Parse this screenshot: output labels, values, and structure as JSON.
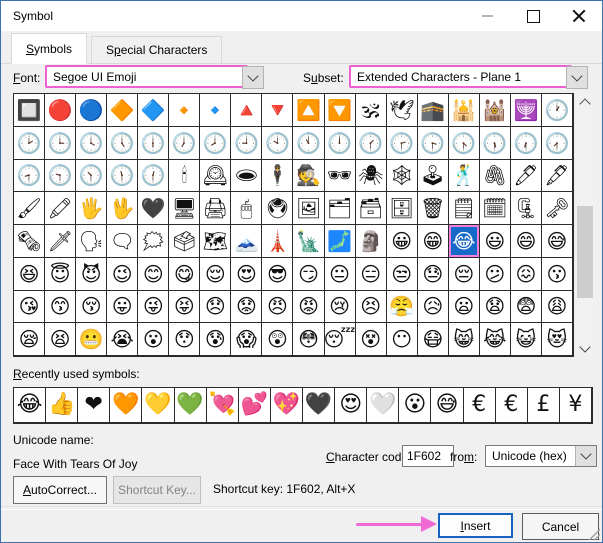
{
  "window": {
    "title": "Symbol"
  },
  "tabs": {
    "symbols": {
      "pre": "",
      "key": "S",
      "post": "ymbols"
    },
    "special_characters": {
      "pre": "S",
      "key": "p",
      "post": "ecial Characters"
    }
  },
  "font_row": {
    "font_label": {
      "pre": "",
      "key": "F",
      "post": "ont:"
    },
    "font_value": "Segoe UI Emoji",
    "subset_label": {
      "pre": "S",
      "key": "u",
      "post": "bset:"
    },
    "subset_value": "Extended Characters - Plane 1"
  },
  "symbol_grid": {
    "rows": [
      [
        "🔲",
        "🔴",
        "🔵",
        "🔶",
        "🔷",
        "🔸",
        "🔹",
        "🔺",
        "🔻",
        "🔼",
        "🔽",
        "🕉",
        "🕊",
        "🕋",
        "🕌",
        "🕍",
        "🕎",
        "🕐"
      ],
      [
        "🕑",
        "🕒",
        "🕓",
        "🕔",
        "🕕",
        "🕖",
        "🕗",
        "🕘",
        "🕙",
        "🕚",
        "🕛",
        "🕜",
        "🕝",
        "🕞",
        "🕟",
        "🕠",
        "🕡",
        "🕢"
      ],
      [
        "🕣",
        "🕤",
        "🕥",
        "🕦",
        "🕧",
        "🕯",
        "🕰",
        "🕳",
        "🕴",
        "🕵",
        "🕶",
        "🕷",
        "🕸",
        "🕹",
        "🕺",
        "🖇",
        "🖊",
        "🖋"
      ],
      [
        "🖌",
        "🖍",
        "🖐",
        "🖖",
        "🖤",
        "🖥",
        "🖨",
        "🖱",
        "🖲",
        "🖼",
        "🗂",
        "🗃",
        "🗄",
        "🗑",
        "🗒",
        "🗓",
        "🗜",
        "🗝"
      ],
      [
        "🗞",
        "🗡",
        "🗣",
        "🗨",
        "🗯",
        "🗳",
        "🗺",
        "🗻",
        "🗼",
        "🗽",
        "🗾",
        "🗿",
        "😀",
        "😁",
        "😂",
        "😃",
        "😄",
        "😅"
      ],
      [
        "😆",
        "😇",
        "😈",
        "😉",
        "😊",
        "😋",
        "😌",
        "😍",
        "😎",
        "😏",
        "😐",
        "😑",
        "😒",
        "😓",
        "😔",
        "😕",
        "😖",
        "😗"
      ],
      [
        "😘",
        "😙",
        "😚",
        "😛",
        "😜",
        "😝",
        "😞",
        "😟",
        "😠",
        "😡",
        "😢",
        "😣",
        "😤",
        "😥",
        "😦",
        "😧",
        "😨",
        "😩"
      ],
      [
        "😪",
        "😫",
        "😬",
        "😭",
        "😮",
        "😯",
        "😰",
        "😱",
        "😲",
        "😳",
        "😴",
        "😵",
        "😶",
        "😷",
        "😸",
        "😹",
        "😺",
        "😻"
      ]
    ],
    "selected": {
      "row": 4,
      "col": 14,
      "char": "😂"
    }
  },
  "recent": {
    "label": {
      "pre": "",
      "key": "R",
      "post": "ecently used symbols:"
    },
    "symbols": [
      "😂",
      "👍",
      "❤",
      "🧡",
      "💛",
      "💚",
      "💘",
      "💕",
      "💖",
      "🖤",
      "😍",
      "🤍",
      "😮",
      "😅",
      "€",
      "€",
      "£",
      "¥"
    ]
  },
  "details": {
    "unicode_name_label": "Unicode name:",
    "unicode_name": "Face With Tears Of Joy",
    "char_code_label": {
      "pre": "",
      "key": "C",
      "post": "haracter code:"
    },
    "char_code": "1F602",
    "from_label": {
      "pre": "fro",
      "key": "m",
      "post": ":"
    },
    "from_value": "Unicode (hex)"
  },
  "actions": {
    "autocorrect_label": {
      "pre": "",
      "key": "A",
      "post": "utoCorrect..."
    },
    "shortcut_key_label": "Shortcut Key...",
    "shortcut_text": "Shortcut key: 1F602, Alt+X"
  },
  "footer": {
    "insert_label": {
      "pre": "",
      "key": "I",
      "post": "nsert"
    },
    "cancel_label": "Cancel"
  },
  "colors": {
    "annotation_pink": "#ee5fd2",
    "selection_blue": "#1569c9",
    "selection_border_pink": "#f07fdf",
    "window_border_blue": "#3f71ad"
  }
}
